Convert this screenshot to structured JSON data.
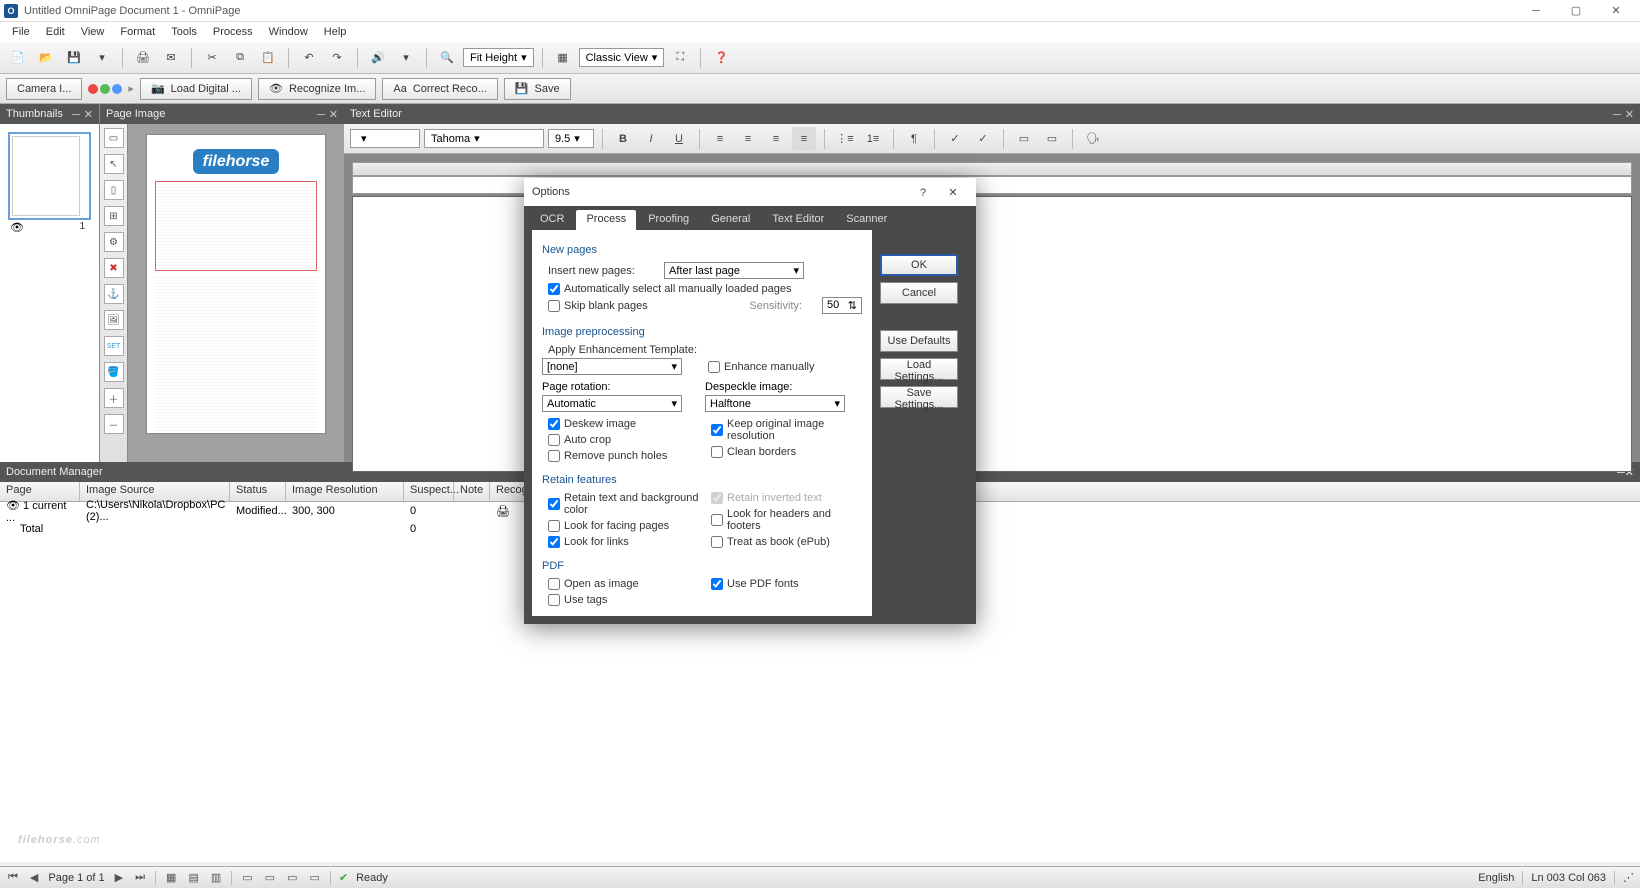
{
  "title": "Untitled OmniPage Document 1 - OmniPage",
  "menus": [
    "File",
    "Edit",
    "View",
    "Format",
    "Tools",
    "Process",
    "Window",
    "Help"
  ],
  "toolbar": {
    "fit_label": "Fit Height",
    "view_label": "Classic View"
  },
  "workflow": {
    "camera": "Camera I...",
    "load": "Load Digital ...",
    "recognize": "Recognize Im...",
    "correct": "Correct Reco...",
    "save": "Save"
  },
  "panels": {
    "thumbs": "Thumbnails",
    "pageimage": "Page Image",
    "texteditor": "Text Editor",
    "docmgr": "Document Manager"
  },
  "editor": {
    "font": "Tahoma",
    "size": "9.5"
  },
  "thumb_page_num": "1",
  "columns": [
    "Page",
    "Image Source",
    "Status",
    "Image Resolution",
    "Suspect...",
    "Note",
    "Recog..."
  ],
  "rows": [
    {
      "page": "1 current ...",
      "src": "C:\\Users\\Nikola\\Dropbox\\PC (2)...",
      "status": "Modified...",
      "res": "300, 300",
      "susp": "0",
      "note": "",
      "recog": "✓"
    },
    {
      "page": "Total",
      "src": "",
      "status": "",
      "res": "",
      "susp": "0",
      "note": "",
      "recog": ""
    }
  ],
  "status": {
    "page": "Page 1 of 1",
    "ready": "Ready",
    "lang": "English",
    "pos": "Ln 003  Col 063"
  },
  "modal": {
    "title": "Options",
    "tabs": [
      "OCR",
      "Process",
      "Proofing",
      "General",
      "Text Editor",
      "Scanner"
    ],
    "active_tab": "Process",
    "buttons": {
      "ok": "OK",
      "cancel": "Cancel",
      "defaults": "Use Defaults",
      "load": "Load Settings...",
      "save": "Save Settings..."
    },
    "sections": {
      "newpages": "New pages",
      "insert_label": "Insert new pages:",
      "insert_value": "After last page",
      "auto_select": "Automatically select all manually loaded pages",
      "skip_blank": "Skip blank pages",
      "sensitivity": "Sensitivity:",
      "sensitivity_value": "50",
      "preproc": "Image preprocessing",
      "enh_label": "Apply Enhancement Template:",
      "enh_value": "[none]",
      "enh_manual": "Enhance manually",
      "rotation_label": "Page rotation:",
      "rotation_value": "Automatic",
      "despeckle_label": "Despeckle image:",
      "despeckle_value": "Halftone",
      "deskew": "Deskew image",
      "keep_res": "Keep original image resolution",
      "autocrop": "Auto crop",
      "clean_borders": "Clean borders",
      "punch": "Remove punch holes",
      "retain": "Retain features",
      "retain_text": "Retain text and background color",
      "retain_inverted": "Retain inverted text",
      "facing": "Look for facing pages",
      "headers": "Look for headers and footers",
      "links": "Look for links",
      "epub": "Treat as book (ePub)",
      "pdf": "PDF",
      "open_image": "Open as image",
      "use_pdf_fonts": "Use PDF fonts",
      "use_tags": "Use tags"
    }
  },
  "watermark_logo": "filehorse",
  "watermark_tld": ".com",
  "watermark_badge": "filehorse"
}
